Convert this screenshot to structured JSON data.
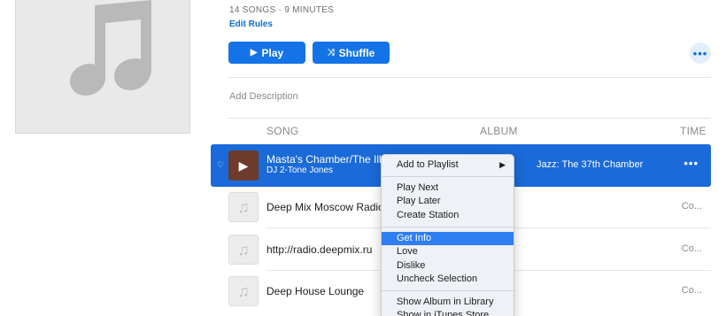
{
  "playlist": {
    "meta": "14 SONGS · 9 MINUTES",
    "edit_rules": "Edit Rules",
    "play_label": "Play",
    "shuffle_label": "Shuffle",
    "description_placeholder": "Add Description",
    "artwork_icon": "music-note-icon"
  },
  "columns": {
    "song": "SONG",
    "album": "ALBUM",
    "time": "TIME"
  },
  "rows": [
    {
      "title": "Masta's Chamber/The Ill Method",
      "artist": "DJ 2-Tone Jones",
      "album": "Jazz: The 37th Chamber",
      "time": "",
      "selected": true
    },
    {
      "title": "Deep Mix Moscow Radio",
      "artist": "",
      "album": "",
      "time": "Co..."
    },
    {
      "title": "http://radio.deepmix.ru",
      "artist": "",
      "album": "",
      "time": "Co..."
    },
    {
      "title": "Deep House Lounge",
      "artist": "",
      "album": "",
      "time": "Co..."
    }
  ],
  "context_menu": {
    "items": [
      "Add to Playlist",
      "Play Next",
      "Play Later",
      "Create Station",
      "Get Info",
      "Love",
      "Dislike",
      "Uncheck Selection",
      "Show Album in Library",
      "Show in iTunes Store"
    ],
    "highlighted": "Get Info"
  },
  "colors": {
    "accent": "#1473e6",
    "selection": "#1a6ad9",
    "menu_highlight": "#2f7ef2"
  }
}
